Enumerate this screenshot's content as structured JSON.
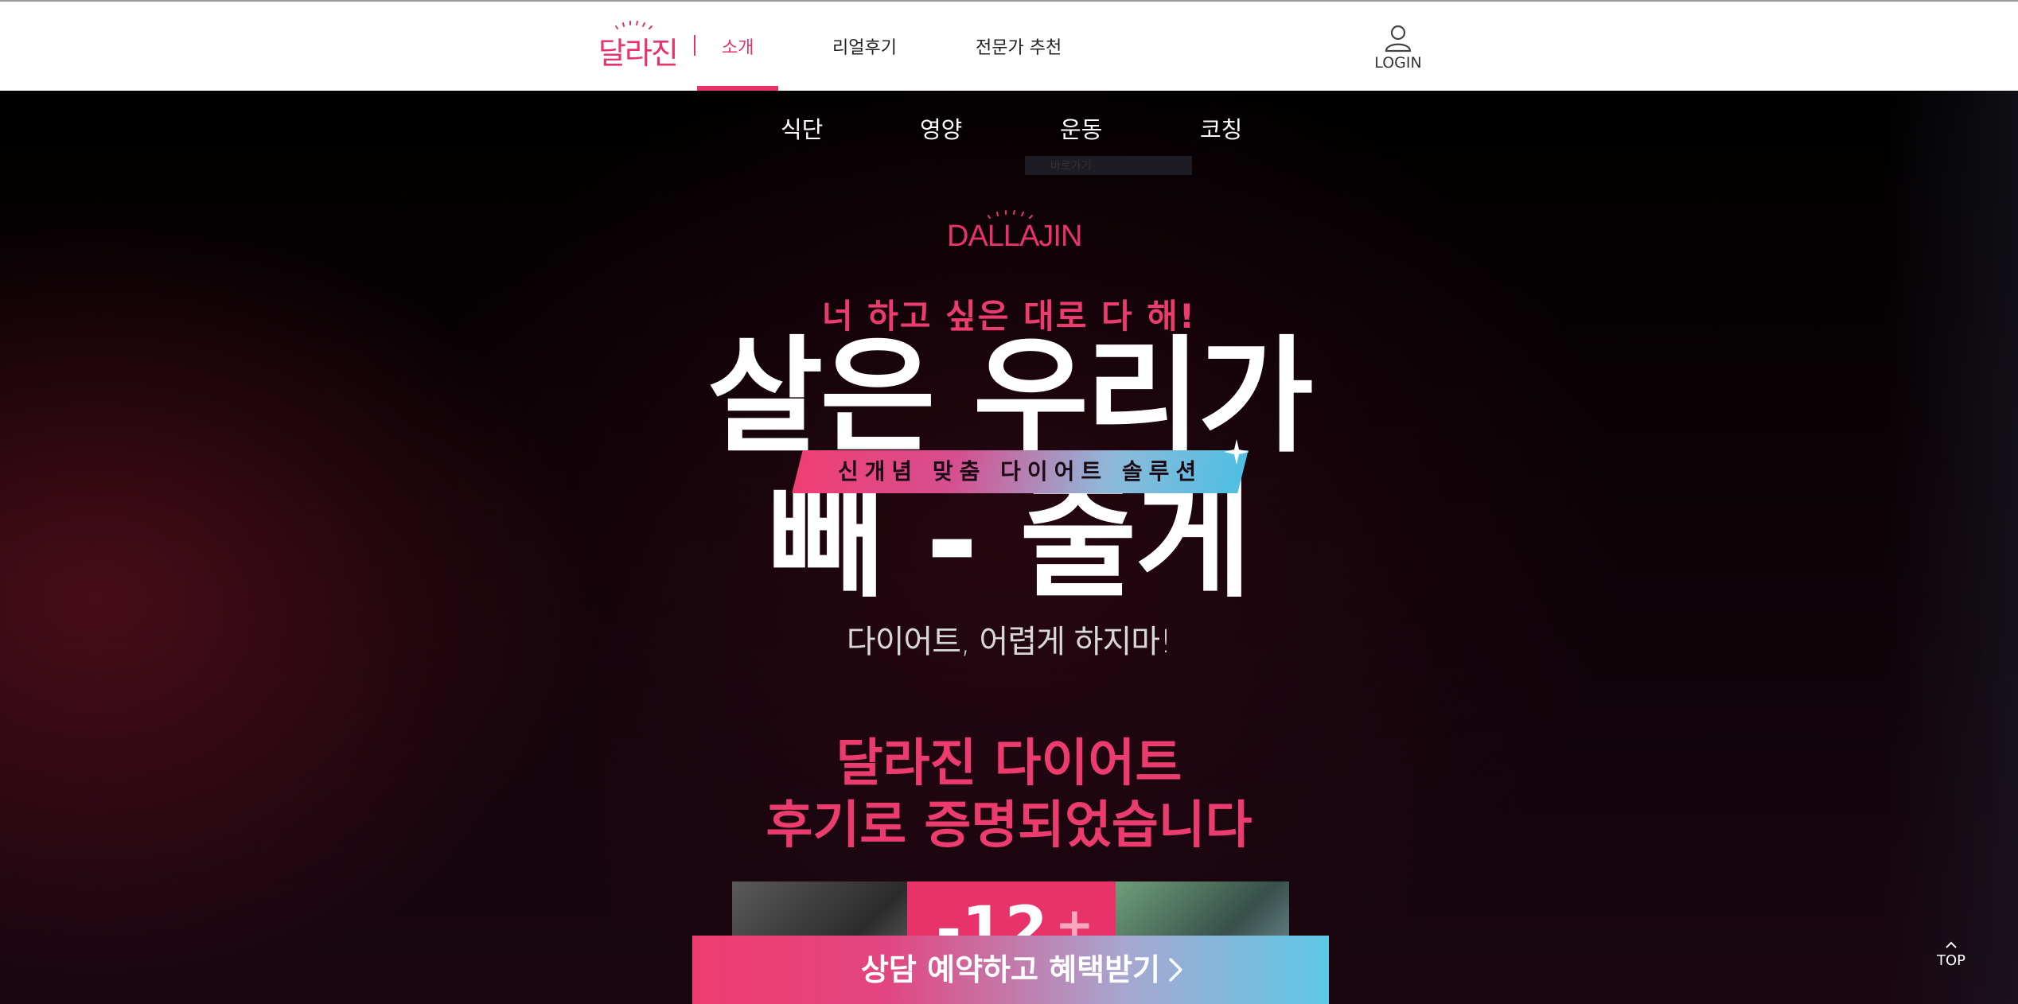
{
  "header": {
    "logo_text": "달라진",
    "nav": [
      {
        "label": "소개",
        "active": true
      },
      {
        "label": "리얼후기",
        "active": false
      },
      {
        "label": "전문가 추천",
        "active": false
      }
    ],
    "login_label": "LOGIN"
  },
  "subnav": [
    {
      "label": "식단"
    },
    {
      "label": "영양"
    },
    {
      "label": "운동"
    },
    {
      "label": "코칭"
    }
  ],
  "tooltip_text": "바로가기",
  "hero": {
    "brand": "DALLAJIN",
    "tagline": "너 하고 싶은 대로 다 해!",
    "headline_line1": "살은 우리가",
    "ribbon": "신개념 맞춤 다이어트 솔루션",
    "headline_line2": "빼 - 줄게",
    "sub_tagline": "다이어트, 어렵게 하지마!",
    "proof_line1": "달라진 다이어트",
    "proof_line2": "후기로 증명되었습니다"
  },
  "reviews": {
    "badge_number": "-12",
    "badge_plus": "+"
  },
  "cta": {
    "label": "상담 예약하고 혜택받기"
  },
  "top_button": {
    "label": "TOP"
  },
  "colors": {
    "accent": "#e8336a",
    "cta_start": "#ef3d72",
    "cta_end": "#5ec8e6",
    "background": "#000000"
  },
  "icons": [
    "user-icon",
    "chevron-right-icon",
    "chevron-up-icon",
    "sparkle-icon"
  ]
}
